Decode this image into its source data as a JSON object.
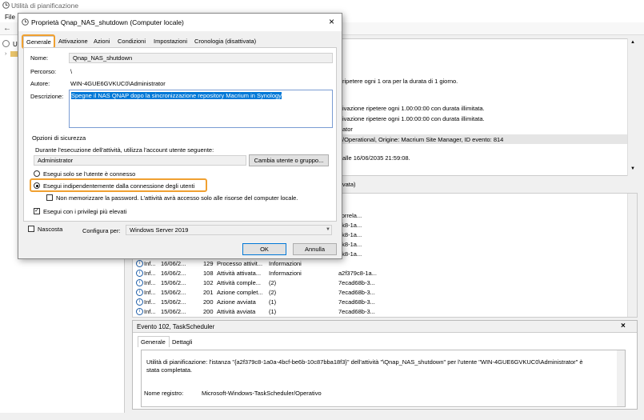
{
  "main_window": {
    "title": "Utilità di pianificazione",
    "menu_file": "File",
    "tree_item": "U"
  },
  "right_top_lines": [
    "ripetere ogni 1 ora per la durata di 1 giorno.",
    "ivazione ripetere ogni 1.00:00:00 con durata illimitata.",
    "ivazione ripetere ogni 1.00:00:00 con durata illimitata.",
    "ator",
    "/Operational, Origine: Macrium Site Manager, ID evento: 814",
    "alle 16/06/2035 21:59:08."
  ],
  "tabs_strip_text": "ttivata)",
  "list_rows": [
    {
      "level": "",
      "date": "",
      "id": "",
      "task": "",
      "op": "",
      "guid": "correla..."
    },
    {
      "level": "",
      "date": "",
      "id": "",
      "task": "",
      "op": "",
      "guid": "9k8-1a..."
    },
    {
      "level": "",
      "date": "",
      "id": "",
      "task": "",
      "op": "",
      "guid": "9k8-1a..."
    },
    {
      "level": "",
      "date": "",
      "id": "",
      "task": "",
      "op": "",
      "guid": "9k8-1a..."
    },
    {
      "level": "",
      "date": "",
      "id": "",
      "task": "",
      "op": "",
      "guid": "9k8-1a..."
    },
    {
      "level": "Inf...",
      "date": "16/06/2...",
      "id": "129",
      "task": "Processo attivit...",
      "op": "Informazioni",
      "guid": ""
    },
    {
      "level": "Inf...",
      "date": "16/06/2...",
      "id": "108",
      "task": "Attività attivata...",
      "op": "Informazioni",
      "guid": "a2f379c8-1a..."
    },
    {
      "level": "Inf...",
      "date": "15/06/2...",
      "id": "102",
      "task": "Attività comple...",
      "op": "(2)",
      "guid": "7ecad68b-3..."
    },
    {
      "level": "Inf...",
      "date": "15/06/2...",
      "id": "201",
      "task": "Azione complet...",
      "op": "(2)",
      "guid": "7ecad68b-3..."
    },
    {
      "level": "Inf...",
      "date": "15/06/2...",
      "id": "200",
      "task": "Azione avviata",
      "op": "(1)",
      "guid": "7ecad68b-3..."
    },
    {
      "level": "Inf...",
      "date": "15/06/2...",
      "id": "200",
      "task": "Attività avviata",
      "op": "(1)",
      "guid": "7ecad68b-3..."
    }
  ],
  "event_panel": {
    "header": "Evento 102, TaskScheduler",
    "tab_general": "Generale",
    "tab_details": "Dettagli",
    "message": "Utilità di pianificazione: l'istanza \"{a2f379c8-1a0a-4bcf-be6b-10c87bba18f3}\" dell'attività \"\\Qnap_NAS_shutdown\" per l'utente \"WIN-4GUE6GVKUC0\\Administrator\" è stata completata.",
    "log_label": "Nome registro:",
    "log_value": "Microsoft-Windows-TaskScheduler/Operativo"
  },
  "dialog": {
    "title": "Proprietà Qnap_NAS_shutdown (Computer locale)",
    "tabs": [
      "Generale",
      "Attivazione",
      "Azioni",
      "Condizioni",
      "Impostazioni",
      "Cronologia (disattivata)"
    ],
    "name_label": "Nome:",
    "name_value": "Qnap_NAS_shutdown",
    "path_label": "Percorso:",
    "path_value": "\\",
    "author_label": "Autore:",
    "author_value": "WIN-4GUE6GVKUC0\\Administrator",
    "desc_label": "Descrizione:",
    "desc_value": "Spegne il NAS QNAP dopo la sincronizzazione repository Macrium in Synology",
    "security_title": "Opzioni di sicurezza",
    "security_account_text": "Durante l'esecuzione dell'attività, utilizza l'account utente seguente:",
    "account_value": "Administrator",
    "change_user_button": "Cambia utente o gruppo...",
    "radio_logged_on": "Esegui solo se l'utente è connesso",
    "radio_independent": "Esegui indipendentemente dalla connessione degli utenti",
    "chk_no_password": "Non memorizzare la password. L'attività avrà accesso solo alle risorse del computer locale.",
    "chk_highest": "Esegui con i privilegi più elevati",
    "chk_hidden": "Nascosta",
    "configure_label": "Configura per:",
    "configure_value": "Windows Server 2019",
    "ok_button": "OK",
    "cancel_button": "Annulla"
  },
  "colors": {
    "highlight": "#f0a030",
    "selection": "#0078d7"
  }
}
